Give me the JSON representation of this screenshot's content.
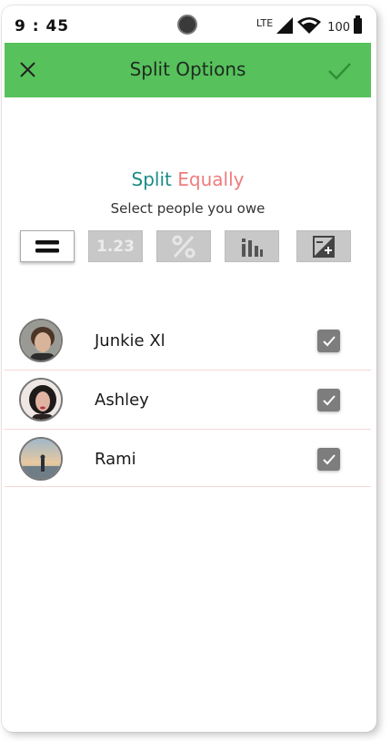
{
  "status_bar": {
    "time": "9 : 45",
    "network": "LTE",
    "battery": "100"
  },
  "app_bar": {
    "title": "Split Options",
    "background_color": "#57c15c",
    "close_icon": "close-icon",
    "confirm_icon": "check-icon"
  },
  "split": {
    "title_word1": "Split",
    "title_word2": "Equally",
    "title_word1_color": "#1b8a86",
    "title_word2_color": "#ef7c7c",
    "subtitle": "Select people you owe"
  },
  "modes": [
    {
      "id": "equal",
      "icon": "equals-icon",
      "active": true
    },
    {
      "id": "exact",
      "label": "1.23",
      "active": false
    },
    {
      "id": "percent",
      "icon": "percent-icon",
      "active": false
    },
    {
      "id": "shares",
      "icon": "shares-icon",
      "active": false
    },
    {
      "id": "adjustment",
      "icon": "adjustment-icon",
      "active": false
    }
  ],
  "people": [
    {
      "name": "Junkie Xl",
      "checked": true
    },
    {
      "name": "Ashley",
      "checked": true
    },
    {
      "name": "Rami",
      "checked": true
    }
  ]
}
